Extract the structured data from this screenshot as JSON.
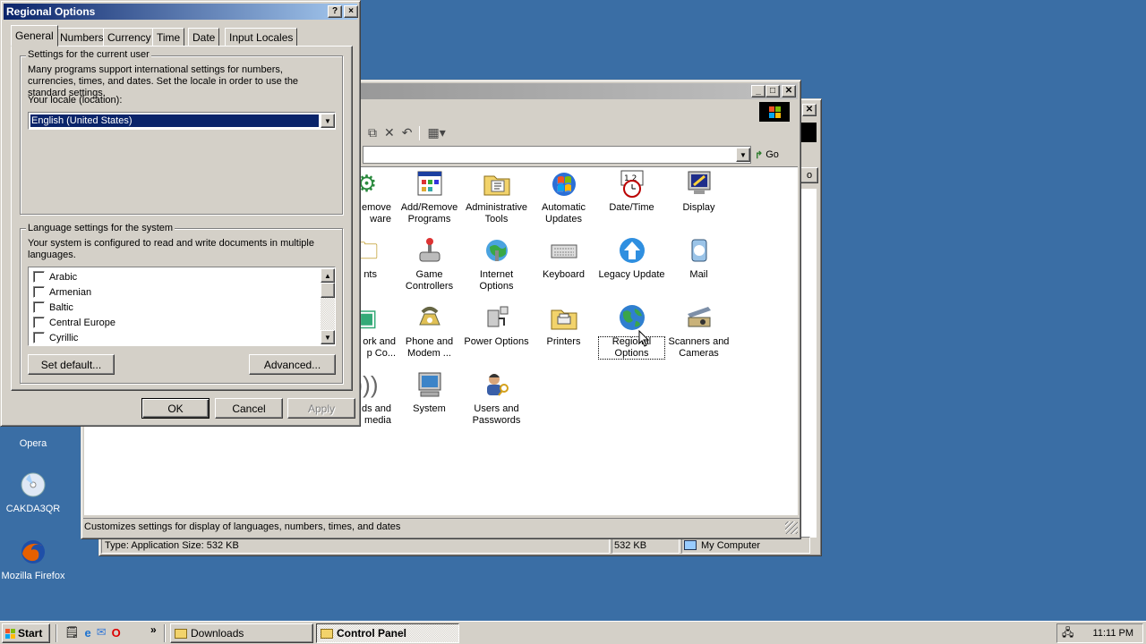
{
  "desktop": {
    "icons": [
      {
        "label": "Opera",
        "icon": "opera-icon"
      },
      {
        "label": "CAKDA3QR",
        "icon": "cd-icon"
      },
      {
        "label": "Mozilla Firefox",
        "icon": "firefox-icon"
      }
    ]
  },
  "control_panel": {
    "title": "Control Panel",
    "go_label": "Go",
    "status_text": "Customizes settings for display of languages, numbers, times, and dates",
    "items": [
      {
        "label": "...emove\n...ware",
        "visible": "emove ware",
        "icon": "add-remove-hardware-icon"
      },
      {
        "label": "Add/Remove Programs",
        "icon": "add-remove-programs-icon"
      },
      {
        "label": "Administrative Tools",
        "icon": "administrative-tools-icon"
      },
      {
        "label": "Automatic Updates",
        "icon": "automatic-updates-icon"
      },
      {
        "label": "Date/Time",
        "icon": "date-time-icon"
      },
      {
        "label": "Display",
        "icon": "display-icon"
      },
      {
        "label": "nts",
        "icon": "fonts-icon"
      },
      {
        "label": "Game Controllers",
        "icon": "game-controllers-icon"
      },
      {
        "label": "Internet Options",
        "icon": "internet-options-icon"
      },
      {
        "label": "Keyboard",
        "icon": "keyboard-icon"
      },
      {
        "label": "Legacy Update",
        "icon": "legacy-update-icon"
      },
      {
        "label": "Mail",
        "icon": "mail-icon"
      },
      {
        "label": "ork and p Co...",
        "icon": "network-icon"
      },
      {
        "label": "Phone and Modem ...",
        "icon": "phone-modem-icon"
      },
      {
        "label": "Power Options",
        "icon": "power-options-icon"
      },
      {
        "label": "Printers",
        "icon": "printers-icon"
      },
      {
        "label": "Regional Options",
        "icon": "regional-options-icon"
      },
      {
        "label": "Scanners and Cameras",
        "icon": "scanners-cameras-icon"
      },
      {
        "label": "ds and media",
        "icon": "sounds-icon"
      },
      {
        "label": "System",
        "icon": "system-icon"
      },
      {
        "label": "Users and Passwords",
        "icon": "users-passwords-icon"
      }
    ]
  },
  "explorer": {
    "status_left": "Type: Application Size: 532 KB",
    "status_size": "532 KB",
    "status_location": "My Computer",
    "go_partial": "o"
  },
  "dialog": {
    "title": "Regional Options",
    "help_label": "?",
    "close_label": "×",
    "tabs": [
      "General",
      "Numbers",
      "Currency",
      "Time",
      "Date",
      "Input Locales"
    ],
    "group1_label": "Settings for the current user",
    "group1_text": "Many programs support international settings for numbers, currencies, times, and dates. Set the locale in order to use the standard settings.",
    "locale_label": "Your locale (location):",
    "locale_value": "English (United States)",
    "group2_label": "Language settings for the system",
    "group2_text": "Your system is configured to read and write documents in multiple languages.",
    "languages": [
      "Arabic",
      "Armenian",
      "Baltic",
      "Central Europe",
      "Cyrillic"
    ],
    "set_default_label": "Set default...",
    "advanced_label": "Advanced...",
    "ok_label": "OK",
    "cancel_label": "Cancel",
    "apply_label": "Apply"
  },
  "taskbar": {
    "start_label": "Start",
    "overflow_label": "»",
    "tasks": [
      "Downloads",
      "Control Panel"
    ],
    "clock": "11:11 PM"
  }
}
